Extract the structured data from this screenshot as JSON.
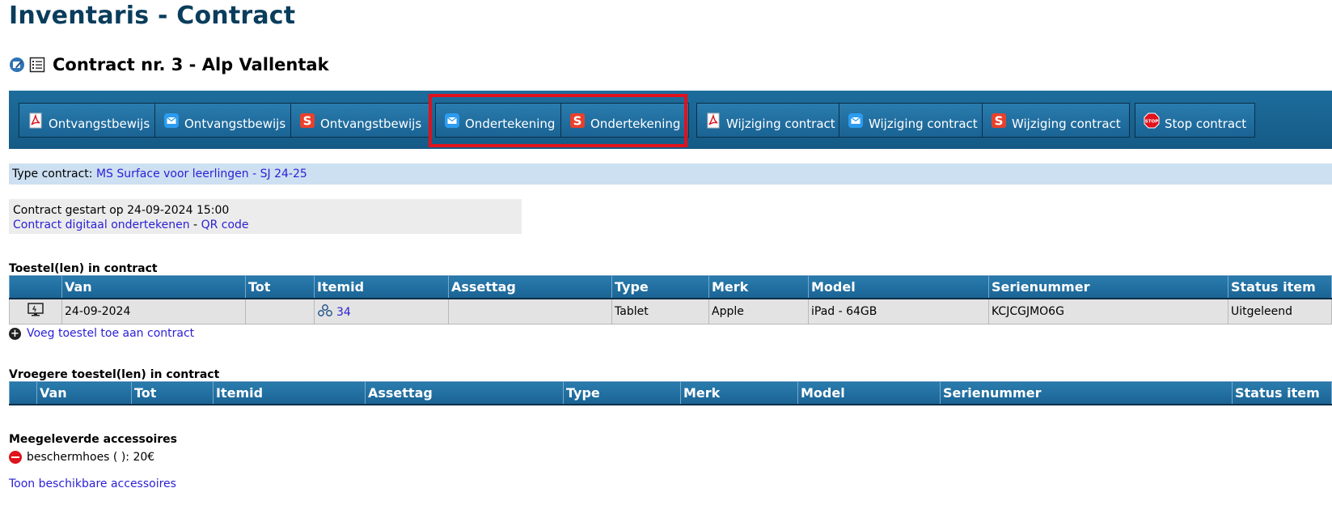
{
  "page_title": "Inventaris - Contract",
  "contract": {
    "title": "Contract nr. 3 - Alp Vallentak"
  },
  "toolbar": {
    "buttons": [
      {
        "label": "Ontvangstbewijs",
        "icon": "pdf-icon"
      },
      {
        "label": "Ontvangstbewijs",
        "icon": "mail-icon"
      },
      {
        "label": "Ontvangstbewijs",
        "icon": "smartschool-icon"
      },
      {
        "label": "Ondertekening",
        "icon": "mail-icon"
      },
      {
        "label": "Ondertekening",
        "icon": "smartschool-icon"
      },
      {
        "label": "Wijziging contract",
        "icon": "pdf-icon"
      },
      {
        "label": "Wijziging contract",
        "icon": "mail-icon"
      },
      {
        "label": "Wijziging contract",
        "icon": "smartschool-icon"
      },
      {
        "label": "Stop contract",
        "icon": "stop-icon"
      }
    ],
    "highlight_color": "#e0121c",
    "bar_color": "#1a6394"
  },
  "type_contract": {
    "label": "Type contract:",
    "value": "MS Surface voor leerlingen - SJ 24-25"
  },
  "start": {
    "text": "Contract gestart op 24-09-2024 15:00",
    "link_sign": "Contract digitaal ondertekenen",
    "separator": "-",
    "link_qr": "QR code"
  },
  "devices": {
    "title": "Toestel(len) in contract",
    "columns": [
      "Van",
      "Tot",
      "Itemid",
      "Assettag",
      "Type",
      "Merk",
      "Model",
      "Serienummer",
      "Status item"
    ],
    "rows": [
      {
        "van": "24-09-2024",
        "tot": "",
        "itemid": "34",
        "assettag": "",
        "type": "Tablet",
        "merk": "Apple",
        "model": "iPad - 64GB",
        "serienummer": "KCJCGJMO6G",
        "status": "Uitgeleend"
      }
    ],
    "add_link": "Voeg toestel toe aan contract"
  },
  "previous_devices": {
    "title": "Vroegere toestel(len) in contract",
    "columns": [
      "Van",
      "Tot",
      "Itemid",
      "Assettag",
      "Type",
      "Merk",
      "Model",
      "Serienummer",
      "Status item"
    ]
  },
  "accessories": {
    "title": "Meegeleverde accessoires",
    "items": [
      {
        "text": "beschermhoes ( ): 20€"
      }
    ],
    "show_link": "Toon beschikbare accessoires"
  }
}
